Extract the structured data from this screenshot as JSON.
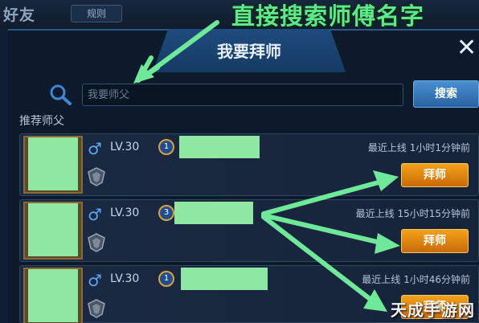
{
  "header": {
    "top_title": "好友",
    "rules_label": "规则",
    "annotation": "直接搜索师傅名字"
  },
  "dialog": {
    "title": "我要拜师",
    "close_glyph": "✕"
  },
  "search": {
    "placeholder": "我要师父",
    "button_label": "搜索"
  },
  "recommended": {
    "label": "推荐师父",
    "cards": [
      {
        "gender_glyph": "♂",
        "level": "LV.30",
        "rank": "1",
        "last_online": "最近上线  1小时1分钟前",
        "button_label": "拜师"
      },
      {
        "gender_glyph": "♂",
        "level": "LV.30",
        "rank": "3",
        "last_online": "最近上线  15小时15分钟前",
        "button_label": "拜师"
      },
      {
        "gender_glyph": "♂",
        "level": "LV.30",
        "rank": "1",
        "last_online": "最近上线  1小时46分钟前",
        "button_label": "拜师"
      }
    ]
  },
  "watermark": "天成手游网",
  "colors": {
    "annotation_green": "#5fe88a",
    "redaction_green": "#8fe8a2",
    "apprentice_orange": "#f3a21a",
    "search_blue": "#3a7cc0"
  }
}
